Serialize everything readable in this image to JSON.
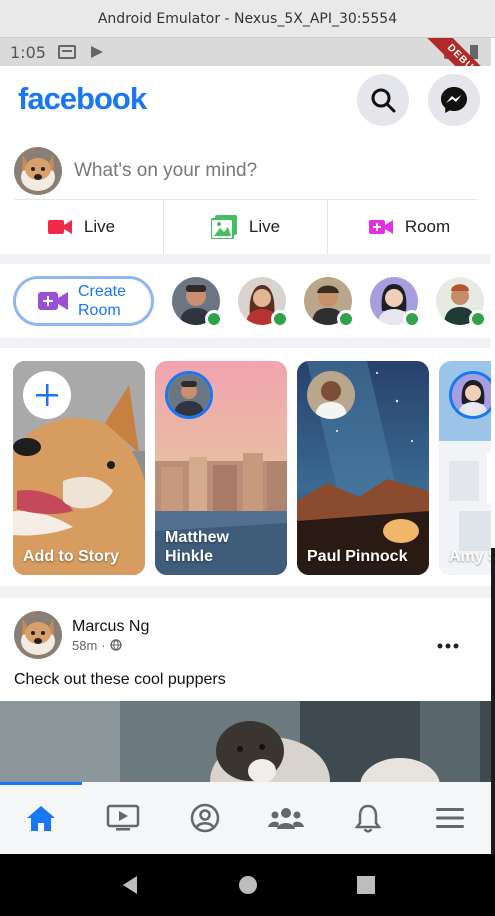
{
  "window": {
    "title": "Android Emulator - Nexus_5X_API_30:5554"
  },
  "status_bar": {
    "time": "1:05",
    "debug_label": "DEBUG"
  },
  "app_bar": {
    "logo": "facebook",
    "icons": [
      "search-icon",
      "messenger-icon"
    ]
  },
  "composer": {
    "placeholder": "What's on your mind?"
  },
  "actions": [
    {
      "label": "Live",
      "icon": "video-icon",
      "color": "#f02849"
    },
    {
      "label": "Live",
      "icon": "photo-icon",
      "color": "#45bd62"
    },
    {
      "label": "Room",
      "icon": "video-plus-icon",
      "color": "#e42fe6"
    }
  ],
  "rooms": {
    "create_label_line1": "Create",
    "create_label_line2": "Room",
    "online_count": 5
  },
  "stories": [
    {
      "name": "Add to Story"
    },
    {
      "name_line1": "Matthew",
      "name_line2": "Hinkle"
    },
    {
      "name": "Paul Pinnock"
    },
    {
      "name": "Amy S"
    }
  ],
  "post": {
    "author": "Marcus Ng",
    "time": "58m",
    "visibility_icon": "globe-icon",
    "text": "Check out these cool puppers"
  },
  "bottom_nav": [
    "home-icon",
    "watch-icon",
    "profile-icon",
    "groups-icon",
    "notifications-icon",
    "menu-icon"
  ],
  "colors": {
    "brand": "#1877f2",
    "online": "#31a24c"
  }
}
